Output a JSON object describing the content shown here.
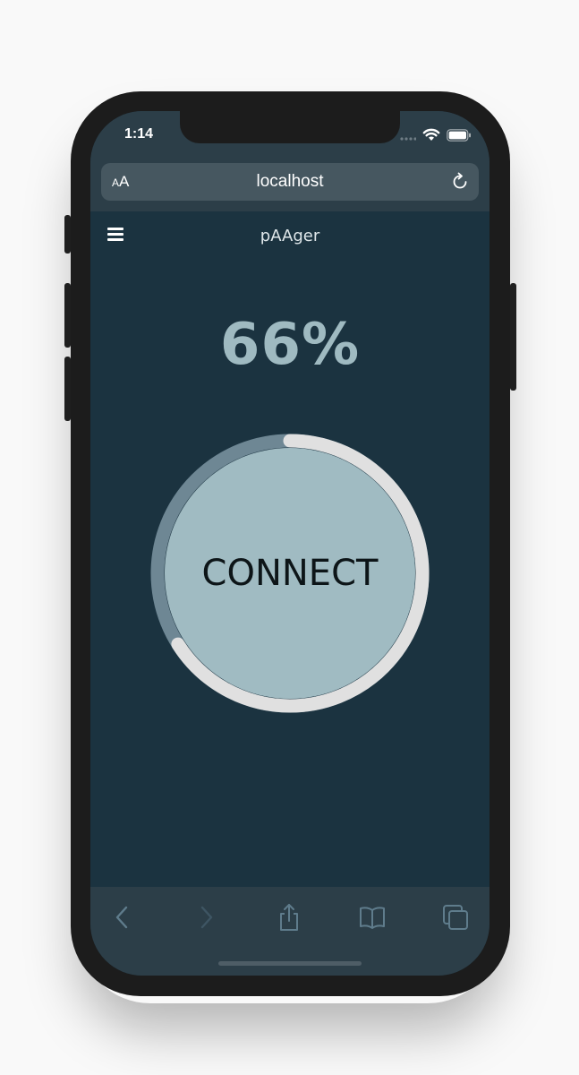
{
  "status_bar": {
    "time": "1:14"
  },
  "browser": {
    "text_size_label": "AA",
    "text_size_small": "A",
    "text_size_large": "A",
    "address": "localhost"
  },
  "app": {
    "title": "pAAger",
    "percent_label": "66%",
    "progress_fraction": 0.66,
    "connect_label": "CONNECT"
  },
  "icons": {
    "menu": "hamburger-menu-icon",
    "reload": "reload-icon",
    "back": "chevron-left-icon",
    "forward": "chevron-right-icon",
    "share": "share-icon",
    "bookmarks": "book-icon",
    "tabs": "tabs-icon",
    "wifi": "wifi-icon",
    "battery": "battery-icon",
    "signal": "signal-icon"
  },
  "colors": {
    "background": "#1b3340",
    "chrome": "#2c3e48",
    "button_fill": "#a0bbc2",
    "gauge_progress": "#e0e0e0",
    "gauge_track": "#6e8794",
    "percent_text": "#9fbac1"
  }
}
